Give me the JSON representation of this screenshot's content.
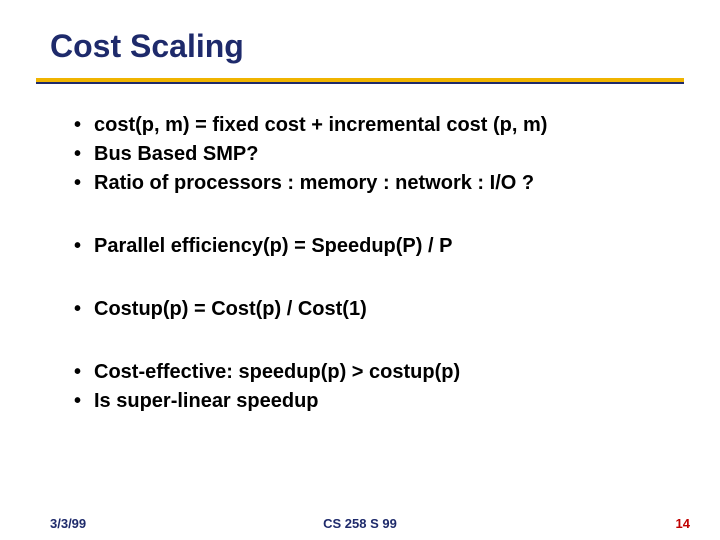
{
  "title": "Cost Scaling",
  "bullets": {
    "g1": [
      "cost(p, m) = fixed cost + incremental cost (p, m)",
      "Bus Based SMP?",
      "Ratio of processors : memory : network : I/O ?"
    ],
    "g2": [
      "Parallel efficiency(p) = Speedup(P) / P"
    ],
    "g3": [
      "Costup(p) = Cost(p) / Cost(1)"
    ],
    "g4": [
      "Cost-effective: speedup(p) > costup(p)",
      "Is super-linear speedup"
    ]
  },
  "footer": {
    "date": "3/3/99",
    "course": "CS 258 S 99",
    "page": "14"
  }
}
